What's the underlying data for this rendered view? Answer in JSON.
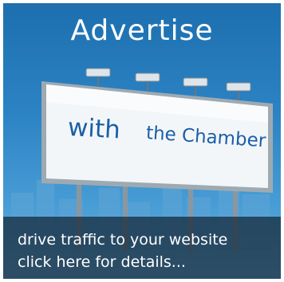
{
  "banner": {
    "title": "Advertise",
    "billboard_line_1": "with",
    "billboard_line_2": "the Chamber",
    "tagline_1": "drive traffic to your website",
    "tagline_2": "click here for details...",
    "sky_color": "#2c83c4",
    "billboard_color": "#eef2f4",
    "text_color": "#1a5fa8"
  }
}
